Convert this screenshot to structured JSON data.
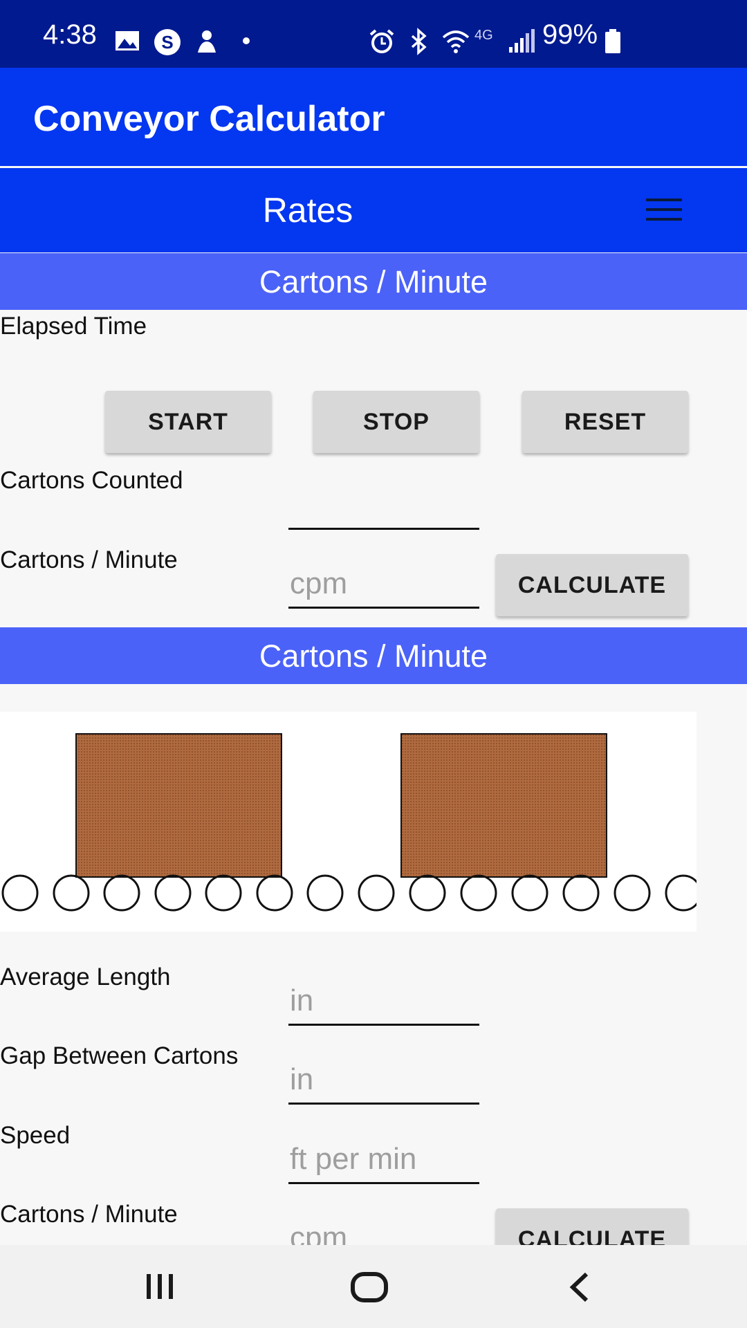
{
  "status_bar": {
    "time": "4:38",
    "network": "4G",
    "battery": "99%",
    "icons": [
      "image-icon",
      "s-app-icon",
      "notification-icon",
      "dot-icon",
      "alarm-icon",
      "bluetooth-icon",
      "wifi-icon",
      "signal-icon",
      "battery-icon"
    ]
  },
  "app": {
    "title": "Conveyor Calculator"
  },
  "toolbar": {
    "title": "Rates",
    "menu_icon": "hamburger-menu-icon"
  },
  "section1": {
    "header": "Cartons / Minute",
    "elapsed_time_label": "Elapsed Time",
    "start_label": "START",
    "stop_label": "STOP",
    "reset_label": "RESET",
    "cartons_counted_label": "Cartons Counted",
    "cpm_label": "Cartons / Minute",
    "cpm_placeholder": "cpm",
    "calculate_label": "CALCULATE"
  },
  "section2": {
    "header": "Cartons / Minute",
    "average_length_label": "Average Length",
    "average_length_placeholder": "in",
    "gap_label": "Gap Between Cartons",
    "gap_placeholder": "in",
    "speed_label": "Speed",
    "speed_placeholder": "ft per min",
    "cpm_label": "Cartons / Minute",
    "cpm_placeholder": "cpm",
    "calculate_label": "CALCULATE"
  },
  "nav": {
    "icons": [
      "recent-apps-icon",
      "home-icon",
      "back-icon"
    ]
  },
  "colors": {
    "status_bar": "#021a8f",
    "app_bar": "#0437f0",
    "section_header": "#4b62f8",
    "carton": "#b06a3f",
    "button": "#d8d8d8"
  }
}
